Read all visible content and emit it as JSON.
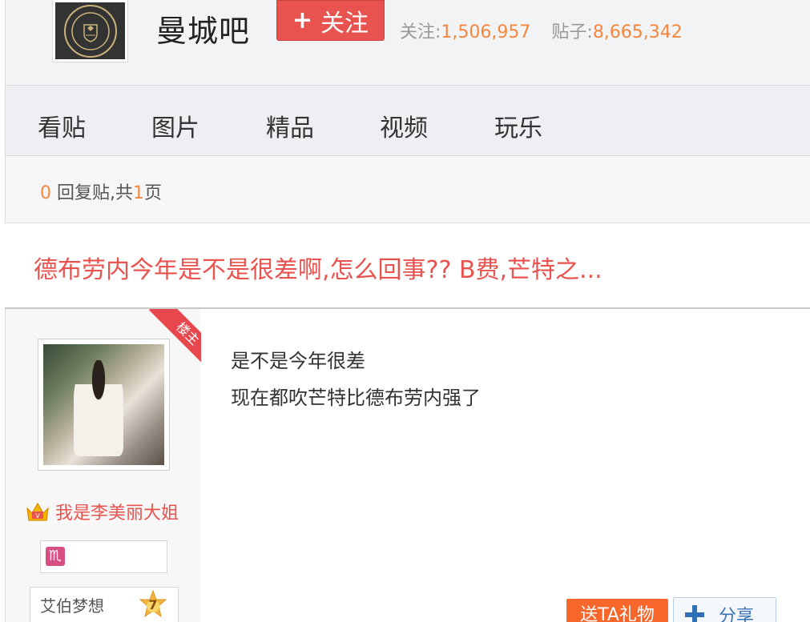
{
  "header": {
    "forum_name": "曼城吧",
    "follow_label": "关注",
    "stats": {
      "followers_label": "关注:",
      "followers_count": "1,506,957",
      "posts_label": "贴子:",
      "posts_count": "8,665,342"
    }
  },
  "nav": {
    "tabs": [
      {
        "label": "看贴"
      },
      {
        "label": "图片"
      },
      {
        "label": "精品"
      },
      {
        "label": "视频"
      },
      {
        "label": "玩乐"
      }
    ]
  },
  "page_info": {
    "reply_count": "0",
    "reply_label": "回复贴,共",
    "page_count": "1",
    "page_label": "页"
  },
  "thread": {
    "title": "德布劳内今年是不是很差啊,怎么回事?? B费,芒特之..."
  },
  "post": {
    "badge": "楼主",
    "author": {
      "username": "我是李美丽大姐",
      "zodiac_glyph": "♏",
      "level_name": "艾伯梦想",
      "level": "7"
    },
    "content_lines": [
      "是不是今年很差",
      "现在都吹芒特比德布劳内强了"
    ],
    "actions": {
      "gift_label": "送TA礼物",
      "share_label": "分享"
    }
  },
  "colors": {
    "accent_red": "#e9534f",
    "number_orange": "#f6863d",
    "gift_orange": "#f7662a",
    "share_blue": "#3a72b8"
  }
}
